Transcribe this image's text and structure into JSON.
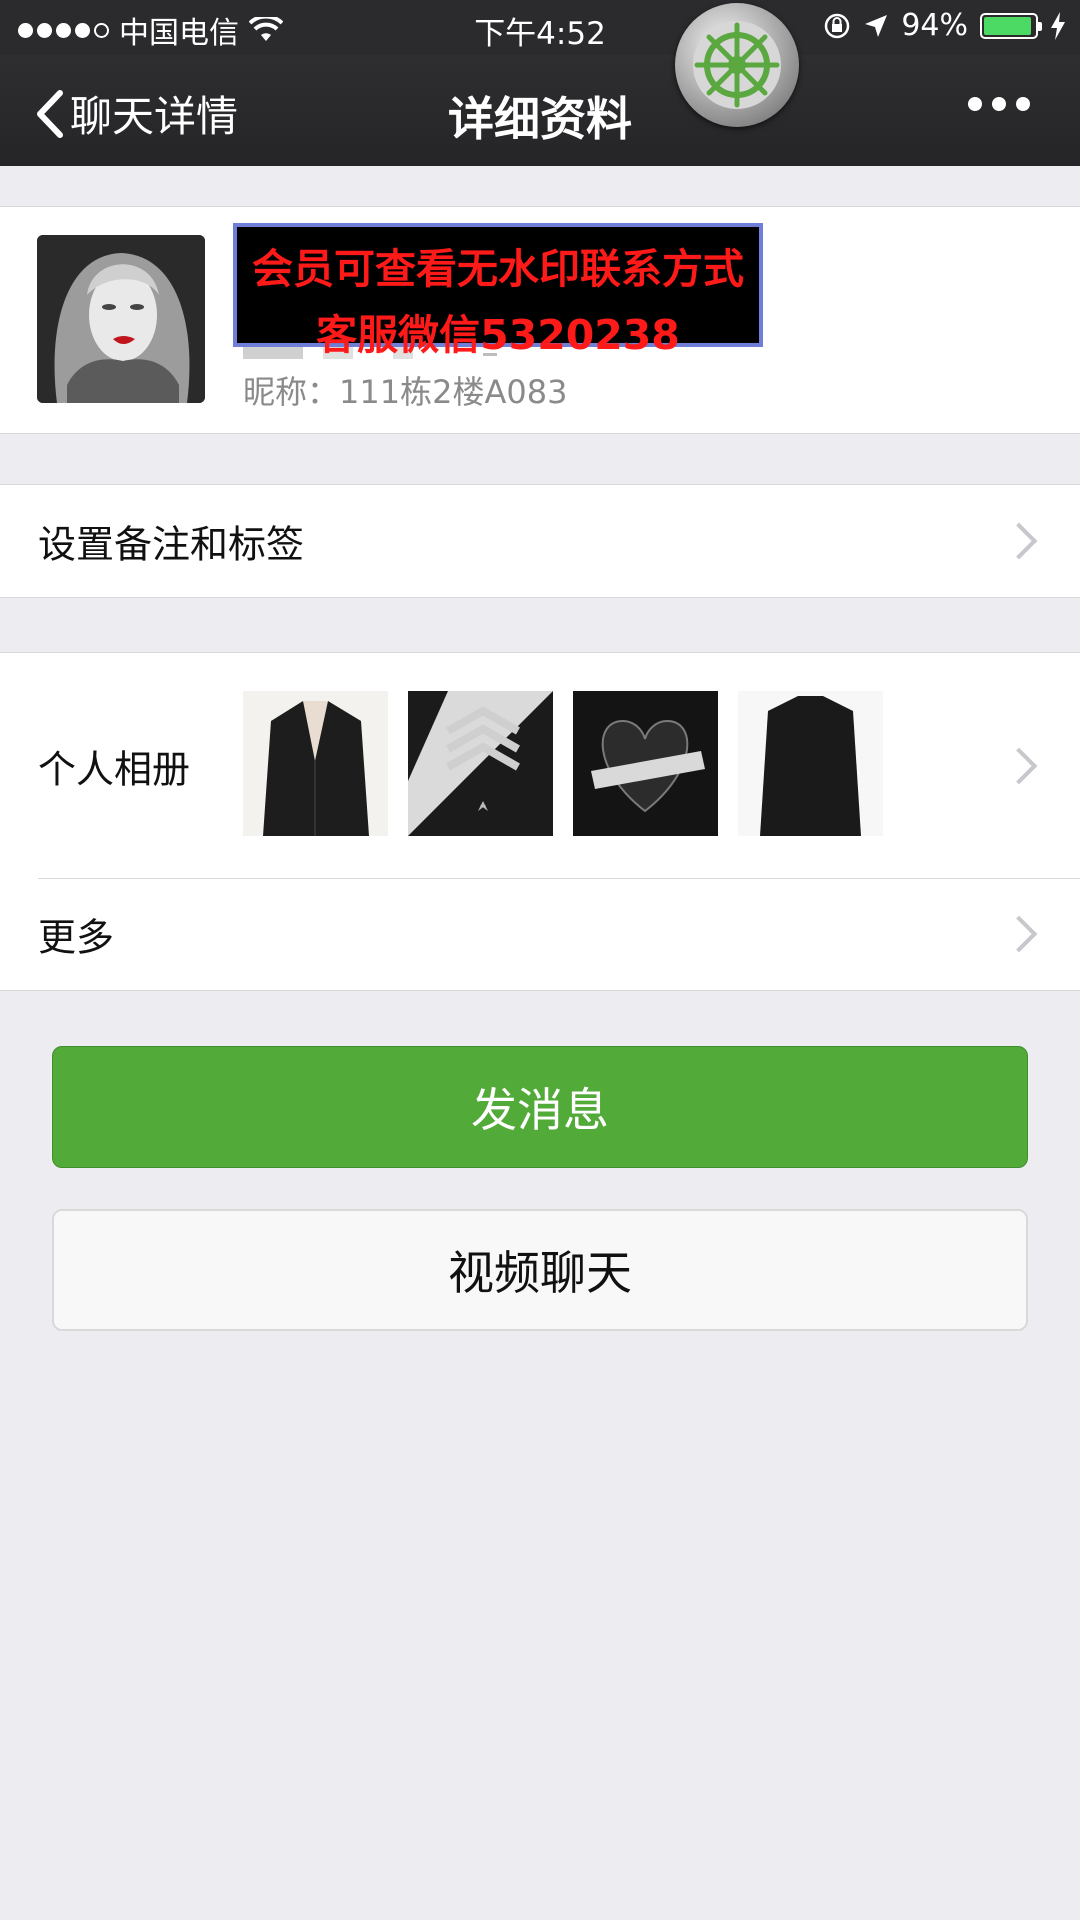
{
  "status_bar": {
    "carrier": "中国电信",
    "time": "下午4:52",
    "battery_text": "94%",
    "battery_level": 0.94,
    "signal_bars_filled": 4,
    "signal_bars_total": 5,
    "icons": [
      "wifi-icon",
      "rotation-lock-icon",
      "location-arrow-icon",
      "battery-icon",
      "charging-bolt-icon"
    ]
  },
  "nav_bar": {
    "back_label": "聊天详情",
    "title": "详细资料",
    "more_icon": "ellipsis-icon"
  },
  "profile": {
    "nickname_label": "昵称：",
    "nickname": "111栋2楼A083"
  },
  "watermark": {
    "line1": "会员可查看无水印联系方式",
    "line2": "客服微信5320238"
  },
  "rows": {
    "remark_label": "设置备注和标签",
    "album_label": "个人相册",
    "more_label": "更多"
  },
  "buttons": {
    "message_label": "发消息",
    "video_label": "视频聊天"
  },
  "colors": {
    "nav_background": "#2b2b2e",
    "primary_green": "#52aa39",
    "page_background": "#ededf1",
    "watermark_red": "#ff1a1a",
    "battery_green": "#4cd964"
  }
}
